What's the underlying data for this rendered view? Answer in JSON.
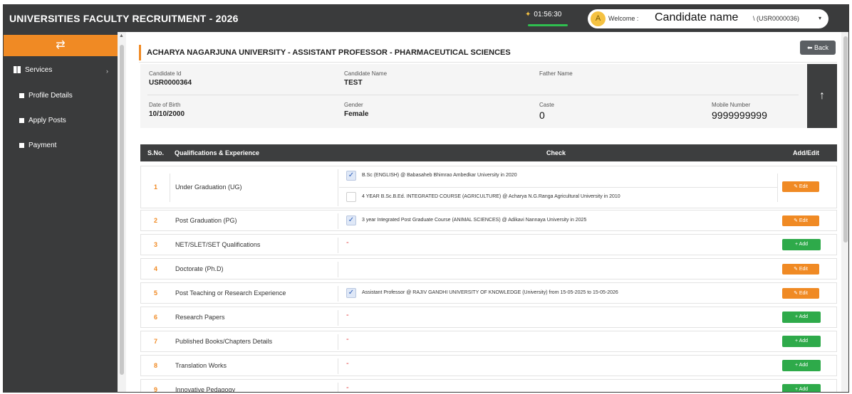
{
  "app": {
    "title": "UNIVERSITIES FACULTY RECRUITMENT - 2026"
  },
  "header": {
    "timer": "01:56:30",
    "welcome_label": "Welcome :",
    "avatar_initial": "A",
    "candidate_name": "Candidate name",
    "user_id": "\\ (USR0000036)"
  },
  "sidebar": {
    "toggle_icon": "⇄",
    "items": [
      {
        "label": "Services",
        "icon": "grid-icon"
      },
      {
        "label": "Profile Details",
        "icon": "square-icon"
      },
      {
        "label": "Apply Posts",
        "icon": "square-icon"
      },
      {
        "label": "Payment",
        "icon": "square-icon"
      }
    ]
  },
  "main": {
    "page_title": "ACHARYA NAGARJUNA UNIVERSITY - ASSISTANT PROFESSOR - PHARMACEUTICAL SCIENCES",
    "back_label": "Back",
    "info": {
      "candidate_id_label": "Candidate Id",
      "candidate_id": "USR0000364",
      "candidate_name_label": "Candidate Name",
      "candidate_name": "TEST",
      "father_name_label": "Father Name",
      "dob_label": "Date of Birth",
      "dob": "10/10/2000",
      "gender_label": "Gender",
      "gender": "Female",
      "caste_label": "Caste",
      "caste": "0",
      "mobile_label": "Mobile Number",
      "mobile": "9999999999"
    },
    "table": {
      "headers": {
        "sno": "S.No.",
        "qual": "Qualifications & Experience",
        "check": "Check",
        "action": "Add/Edit"
      },
      "edit_label": "Edit",
      "add_label": "+ Add",
      "rows": [
        {
          "sno": "1",
          "name": "Under Graduation (UG)",
          "details": [
            {
              "checked": true,
              "text": "B.Sc (ENGLISH) @ Babasaheb Bhimrao Ambedkar University in 2020"
            },
            {
              "checked": false,
              "text": "4 YEAR B.Sc.B.Ed. INTEGRATED COURSE (AGRICULTURE) @ Acharya N.G.Ranga Agricultural University in 2010"
            }
          ],
          "action": "Edit"
        },
        {
          "sno": "2",
          "name": "Post Graduation (PG)",
          "details": [
            {
              "checked": true,
              "text": "3 year Integrated Post Graduate Course (ANIMAL SCIENCES) @ Adikavi Nannaya University in 2025"
            }
          ],
          "action": "Edit"
        },
        {
          "sno": "3",
          "name": "NET/SLET/SET Qualifications",
          "dash": "-",
          "action": "Add"
        },
        {
          "sno": "4",
          "name": "Doctorate (Ph.D)",
          "action": "Edit"
        },
        {
          "sno": "5",
          "name": "Post Teaching or Research Experience",
          "details": [
            {
              "checked": true,
              "text": "Assistant Professor @ RAJIV GANDHI UNIVERSITY OF KNOWLEDGE (University) from 15-05-2025 to 15-05-2026"
            }
          ],
          "action": "Edit"
        },
        {
          "sno": "6",
          "name": "Research Papers",
          "dash": "-",
          "action": "Add"
        },
        {
          "sno": "7",
          "name": "Published Books/Chapters Details",
          "dash": "-",
          "action": "Add"
        },
        {
          "sno": "8",
          "name": "Translation Works",
          "dash": "-",
          "action": "Add"
        },
        {
          "sno": "9",
          "name": "Innovative Pedagogy",
          "dash": "-",
          "action": "Add"
        }
      ]
    }
  },
  "colors": {
    "accent": "#f08a24",
    "dark": "#3a3b3c",
    "add": "#2eaa4a",
    "check": "#2b5cb8"
  }
}
